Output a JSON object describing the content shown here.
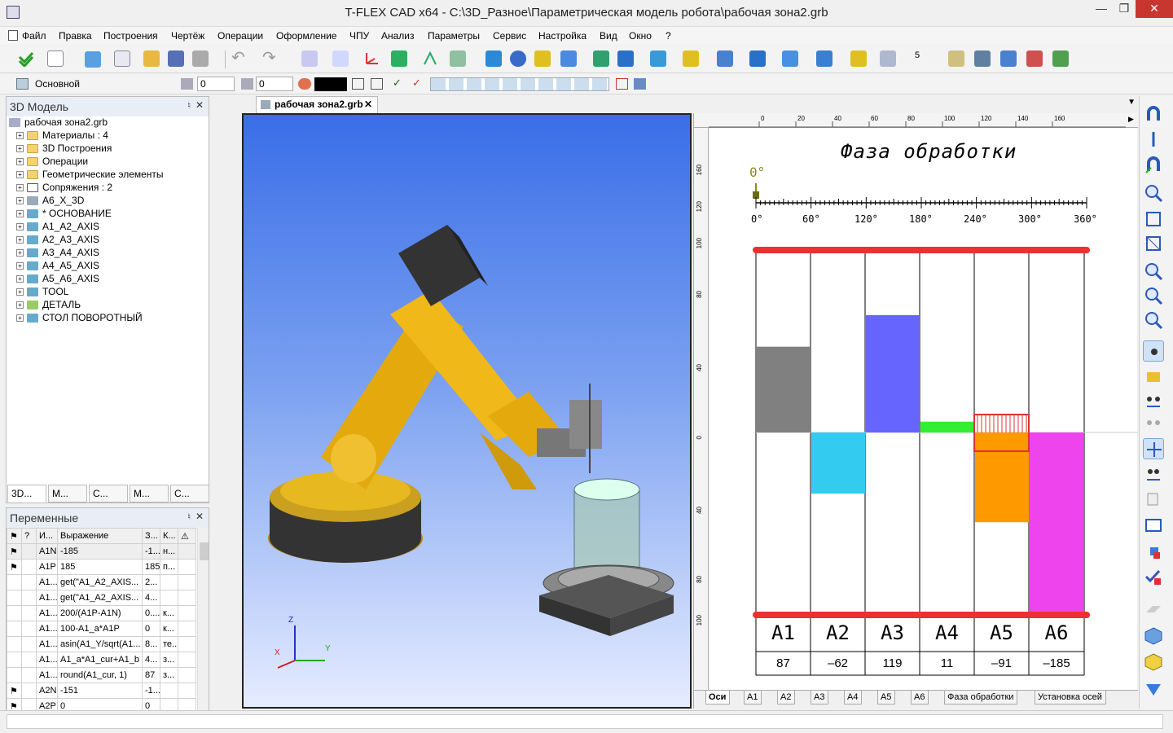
{
  "window": {
    "title": "T-FLEX CAD x64 - C:\\3D_Разное\\Параметрическая модель робота\\рабочая зона2.grb"
  },
  "menu": [
    "Файл",
    "Правка",
    "Построения",
    "Чертёж",
    "Операции",
    "Оформление",
    "ЧПУ",
    "Анализ",
    "Параметры",
    "Сервис",
    "Настройка",
    "Вид",
    "Окно",
    "?"
  ],
  "layerbar": {
    "layer": "Основной",
    "value1": "0",
    "value2": "0"
  },
  "model_panel": {
    "title": "3D Модель",
    "root": "рабочая зона2.grb",
    "items": [
      "Материалы : 4",
      "3D Построения",
      "Операции",
      "Геометрические элементы",
      "Сопряжения : 2",
      "A6_X_3D",
      "* ОСНОВАНИЕ",
      "A1_A2_AXIS",
      "A2_A3_AXIS",
      "A3_A4_AXIS",
      "A4_A5_AXIS",
      "A5_A6_AXIS",
      "TOOL",
      "ДЕТАЛЬ",
      "СТОЛ ПОВОРОТНЫЙ"
    ],
    "tabs": [
      "3D...",
      "М...",
      "С...",
      "М...",
      "С..."
    ]
  },
  "vars_panel": {
    "title": "Переменные",
    "columns": [
      "?",
      "И...",
      "Выражение",
      "З...",
      "К..."
    ],
    "rows": [
      [
        "A1N",
        "-185",
        "-1...",
        "н..."
      ],
      [
        "A1P",
        "185",
        "185",
        "п..."
      ],
      [
        "A1...",
        "get(\"A1_A2_AXIS...",
        "2...",
        ""
      ],
      [
        "A1...",
        "get(\"A1_A2_AXIS...",
        "4...",
        ""
      ],
      [
        "A1...",
        "200/(A1P-A1N)",
        "0....",
        "к..."
      ],
      [
        "A1...",
        "100-A1_a*A1P",
        "0",
        "к..."
      ],
      [
        "A1...",
        "asin(A1_Y/sqrt(A1...",
        "8...",
        "те..."
      ],
      [
        "A1...",
        "A1_a*A1_cur+A1_b",
        "4...",
        "з..."
      ],
      [
        "A1...",
        "round(A1_cur, 1)",
        "87",
        "з..."
      ],
      [
        "A2N",
        "-151",
        "-1...",
        ""
      ],
      [
        "A2P",
        "0",
        "0",
        ""
      ]
    ]
  },
  "doc_tab": {
    "label": "рабочая зона2.grb"
  },
  "axes_3d": {
    "z": "Z",
    "x": "X",
    "y": "Y"
  },
  "drawing": {
    "title": "Фаза обработки",
    "angle_value": "0°",
    "ruler_marks": [
      "0°",
      "60°",
      "120°",
      "180°",
      "240°",
      "300°",
      "360°"
    ],
    "top_ruler": [
      "0",
      "20",
      "40",
      "60",
      "80",
      "100",
      "120",
      "140",
      "160"
    ],
    "side_ruler": [
      "160",
      "140",
      "120",
      "100",
      "80",
      "60",
      "40",
      "20",
      "0",
      "20",
      "40",
      "60",
      "80",
      "100"
    ],
    "axes": [
      {
        "name": "A1",
        "value": "87",
        "color": "#808080"
      },
      {
        "name": "A2",
        "value": "–62",
        "color": "#33ccf0"
      },
      {
        "name": "A3",
        "value": "119",
        "color": "#6666ff"
      },
      {
        "name": "A4",
        "value": "11",
        "color": "#33ee33"
      },
      {
        "name": "A5",
        "value": "–91",
        "color": "#ff9900"
      },
      {
        "name": "A6",
        "value": "–185",
        "color": "#ee44ee"
      }
    ],
    "bottom_tabs": [
      "Оси",
      "A1",
      "A2",
      "A3",
      "A4",
      "A5",
      "A6",
      "Фаза обработки",
      "Установка осей"
    ]
  }
}
